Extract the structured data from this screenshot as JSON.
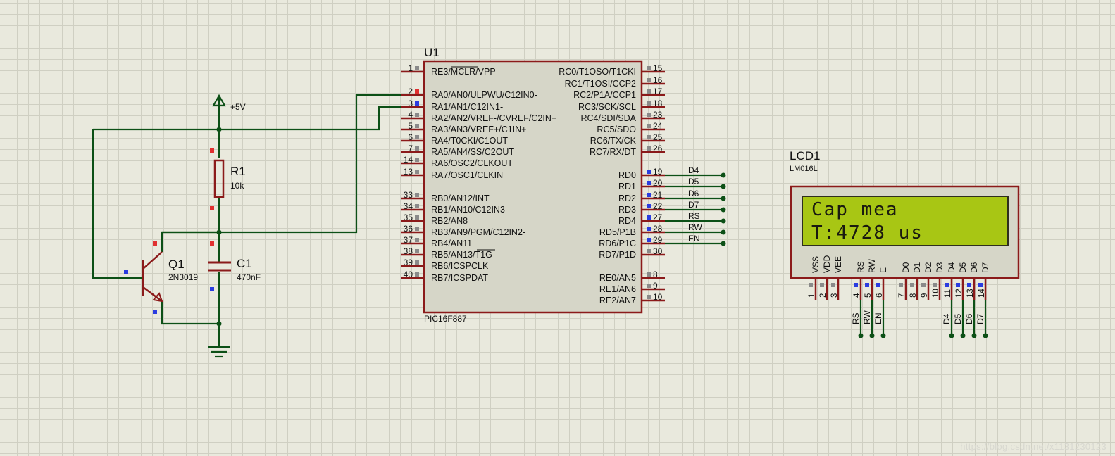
{
  "labels": {
    "u1_ref": "U1",
    "u1_part": "PIC16F887",
    "r1_ref": "R1",
    "r1_value": "10k",
    "c1_ref": "C1",
    "c1_value": "470nF",
    "q1_ref": "Q1",
    "q1_part": "2N3019",
    "power": "+5V",
    "lcd_ref": "LCD1",
    "lcd_part": "LM016L"
  },
  "lcd_display": {
    "line1": "Cap mea",
    "line2": "T:4728 us"
  },
  "mcu_left_pins": [
    {
      "num": "1",
      "name": "RE3/MCLR/VPP"
    },
    {
      "num": "2",
      "name": "RA0/AN0/ULPWU/C12IN0-"
    },
    {
      "num": "3",
      "name": "RA1/AN1/C12IN1-"
    },
    {
      "num": "4",
      "name": "RA2/AN2/VREF-/CVREF/C2IN+"
    },
    {
      "num": "5",
      "name": "RA3/AN3/VREF+/C1IN+"
    },
    {
      "num": "6",
      "name": "RA4/T0CKI/C1OUT"
    },
    {
      "num": "7",
      "name": "RA5/AN4/SS/C2OUT"
    },
    {
      "num": "14",
      "name": "RA6/OSC2/CLKOUT"
    },
    {
      "num": "13",
      "name": "RA7/OSC1/CLKIN"
    },
    {
      "num": "33",
      "name": "RB0/AN12/INT"
    },
    {
      "num": "34",
      "name": "RB1/AN10/C12IN3-"
    },
    {
      "num": "35",
      "name": "RB2/AN8"
    },
    {
      "num": "36",
      "name": "RB3/AN9/PGM/C12IN2-"
    },
    {
      "num": "37",
      "name": "RB4/AN11"
    },
    {
      "num": "38",
      "name": "RB5/AN13/T1G"
    },
    {
      "num": "39",
      "name": "RB6/ICSPCLK"
    },
    {
      "num": "40",
      "name": "RB7/ICSPDAT"
    }
  ],
  "mcu_right_pins": [
    {
      "num": "15",
      "name": "RC0/T1OSO/T1CKI"
    },
    {
      "num": "16",
      "name": "RC1/T1OSI/CCP2"
    },
    {
      "num": "17",
      "name": "RC2/P1A/CCP1"
    },
    {
      "num": "18",
      "name": "RC3/SCK/SCL"
    },
    {
      "num": "23",
      "name": "RC4/SDI/SDA"
    },
    {
      "num": "24",
      "name": "RC5/SDO"
    },
    {
      "num": "25",
      "name": "RC6/TX/CK"
    },
    {
      "num": "26",
      "name": "RC7/RX/DT"
    },
    {
      "num": "19",
      "name": "RD0"
    },
    {
      "num": "20",
      "name": "RD1"
    },
    {
      "num": "21",
      "name": "RD2"
    },
    {
      "num": "22",
      "name": "RD3"
    },
    {
      "num": "27",
      "name": "RD4"
    },
    {
      "num": "28",
      "name": "RD5/P1B"
    },
    {
      "num": "29",
      "name": "RD6/P1C"
    },
    {
      "num": "30",
      "name": "RD7/P1D"
    },
    {
      "num": "8",
      "name": "RE0/AN5"
    },
    {
      "num": "9",
      "name": "RE1/AN6"
    },
    {
      "num": "10",
      "name": "RE2/AN7"
    }
  ],
  "mcu_net_labels": [
    "D4",
    "D5",
    "D6",
    "D7",
    "RS",
    "RW",
    "EN"
  ],
  "lcd_pins": [
    {
      "num": "1",
      "name": "VSS"
    },
    {
      "num": "2",
      "name": "VDD"
    },
    {
      "num": "3",
      "name": "VEE"
    },
    {
      "num": "4",
      "name": "RS"
    },
    {
      "num": "5",
      "name": "RW"
    },
    {
      "num": "6",
      "name": "E"
    },
    {
      "num": "7",
      "name": "D0"
    },
    {
      "num": "8",
      "name": "D1"
    },
    {
      "num": "9",
      "name": "D2"
    },
    {
      "num": "10",
      "name": "D3"
    },
    {
      "num": "11",
      "name": "D4"
    },
    {
      "num": "12",
      "name": "D5"
    },
    {
      "num": "13",
      "name": "D6"
    },
    {
      "num": "14",
      "name": "D7"
    }
  ],
  "lcd_net_labels": [
    "RS",
    "RW",
    "EN",
    "D4",
    "D5",
    "D6",
    "D7"
  ],
  "watermark": "https://blog.csdn.net/x1131230123",
  "colors": {
    "wire": "#0c5016",
    "body": "#8b1a1a",
    "chip_fill": "#d6d6c8",
    "lcd_screen": "#a8c614",
    "pin_red": "#e03030",
    "pin_blue": "#2a3ce0",
    "pin_gray": "#8a8a8a"
  }
}
